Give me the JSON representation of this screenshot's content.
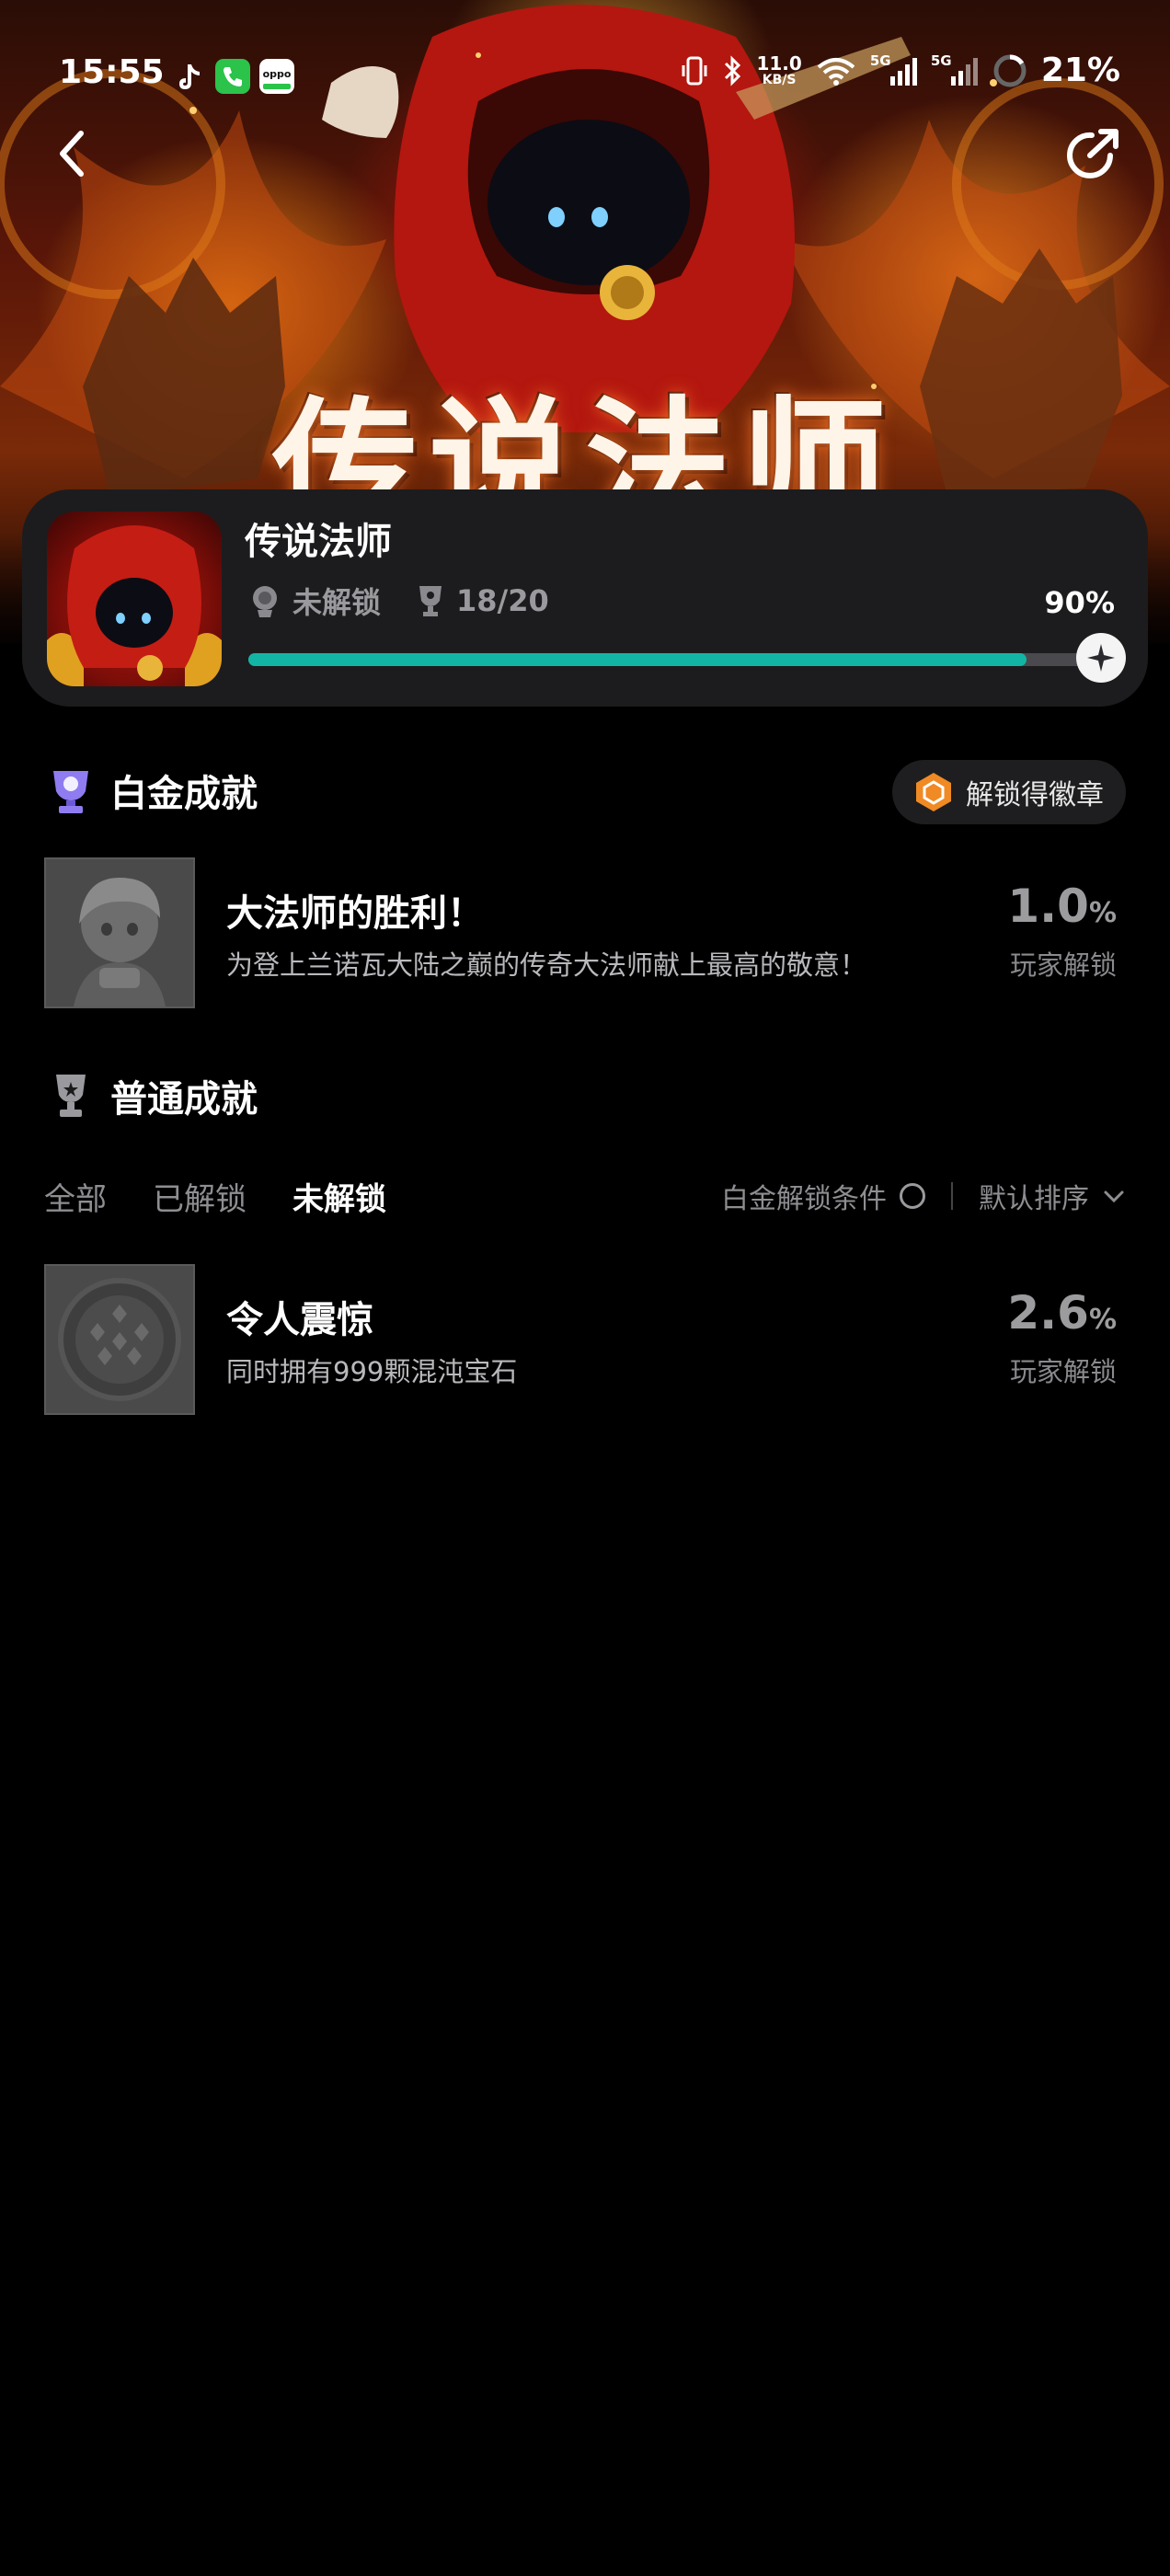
{
  "status_bar": {
    "time": "15:55",
    "net_speed_value": "11.0",
    "net_speed_unit": "KB/S",
    "signal_labels": [
      "5G",
      "5G"
    ],
    "battery": "21%",
    "icons": [
      "tiktok-icon",
      "phone-icon",
      "oppo-store-icon",
      "vibrate-icon",
      "bluetooth-icon",
      "wifi-icon",
      "signal-icon",
      "battery-ring-icon"
    ]
  },
  "hero": {
    "title": "传说法师"
  },
  "nav": {
    "back_icon": "chevron-left-icon",
    "share_icon": "share-icon"
  },
  "game": {
    "name": "传说法师",
    "platinum_status": "未解锁",
    "trophy_count": "18/20",
    "progress_percent": "90%",
    "progress_fraction": 0.9
  },
  "platinum": {
    "section_title": "白金成就",
    "badge_button": "解锁得徽章",
    "achievement": {
      "title": "大法师的胜利！",
      "description": "为登上兰诺瓦大陆之巅的传奇大法师献上最高的敬意！",
      "rate_value": "1.0",
      "rate_unit": "%",
      "rate_label": "玩家解锁"
    }
  },
  "normal": {
    "section_title": "普通成就",
    "tabs": [
      "全部",
      "已解锁",
      "未解锁"
    ],
    "active_tab": 2,
    "filter_label": "白金解锁条件",
    "sort_label": "默认排序",
    "achievements": [
      {
        "title": "令人震惊",
        "description": "同时拥有999颗混沌宝石",
        "rate_value": "2.6",
        "rate_unit": "%",
        "rate_label": "玩家解锁"
      }
    ]
  },
  "colors": {
    "accent": "#12b5a5",
    "card_bg": "#1c1c1e",
    "badge_orange": "#f08a24"
  }
}
